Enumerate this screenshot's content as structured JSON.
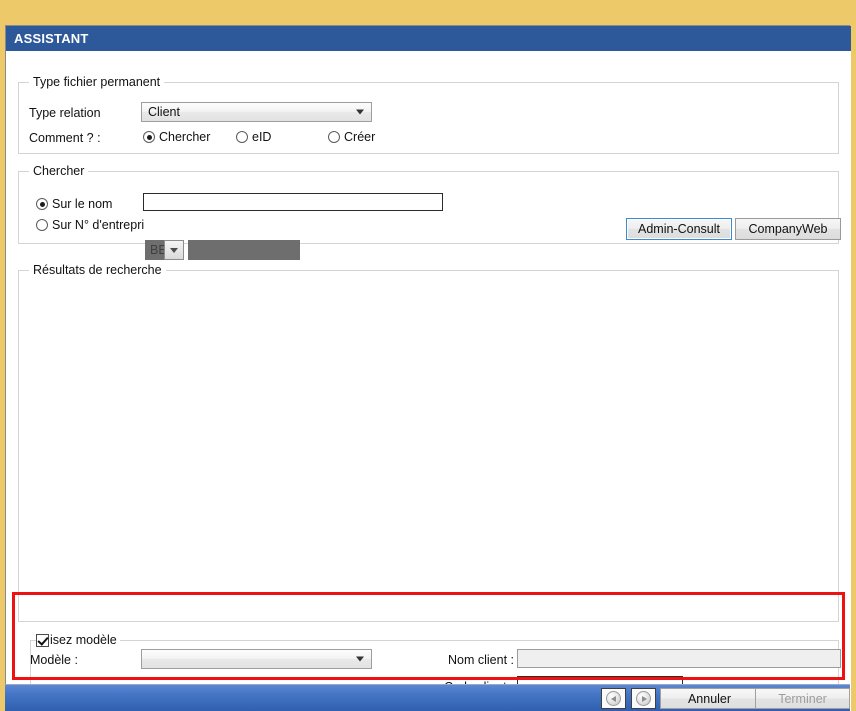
{
  "window": {
    "title": "ASSISTANT"
  },
  "groups": {
    "file_type": {
      "legend": "Type fichier permanent",
      "type_relation_label": "Type relation",
      "type_relation_value": "Client",
      "comment_label": "Comment ? :",
      "options": [
        {
          "label": "Chercher",
          "checked": true
        },
        {
          "label": "eID",
          "checked": false
        },
        {
          "label": "Créer",
          "checked": false
        }
      ]
    },
    "search": {
      "legend": "Chercher",
      "by_name_label": "Sur le nom",
      "by_name_checked": true,
      "by_name_value": "",
      "by_name_placeholder": "",
      "by_number_label": "Sur N° d'entrepri",
      "by_number_checked": false,
      "country_prefix": "BE",
      "number_value": "",
      "buttons": [
        {
          "label": "Admin-Consult",
          "focused": true
        },
        {
          "label": "CompanyWeb",
          "focused": false
        }
      ]
    },
    "results": {
      "legend": "Résultats de recherche",
      "rows": []
    },
    "template": {
      "legend": "isez modèle",
      "legend_checked": true,
      "model_label": "Modèle :",
      "model_value": "",
      "client_name_label": "Nom client :",
      "client_name_value": "",
      "client_code_label": "Code client :",
      "client_code_value": ""
    }
  },
  "footer": {
    "back_icon": "arrow-left-circle-icon",
    "forward_icon": "arrow-right-circle-icon",
    "cancel_label": "Annuler",
    "finish_label": "Terminer",
    "finish_disabled": true
  },
  "colors": {
    "frame": "#eec96a",
    "title_bar": "#2d5899",
    "highlight": "#ee1111",
    "footer_bar": "#4576c6"
  }
}
